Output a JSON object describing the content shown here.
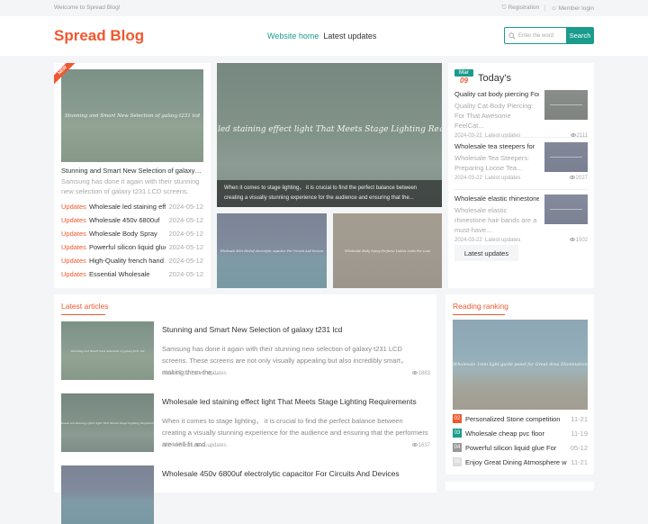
{
  "topbar": {
    "welcome": "Welcome to Spread Blog!",
    "registration": "Registration",
    "member_login": "Member login"
  },
  "header": {
    "logo": "Spread Blog",
    "nav": [
      {
        "label": "Website home",
        "active": true
      },
      {
        "label": "Latest updates",
        "active": false
      }
    ],
    "search_placeholder": "Enter the word",
    "search_button": "Search"
  },
  "featured": {
    "badge": "NEW",
    "image_caption": "Stunning and Smart New Selection of galaxy t231 lcd",
    "title": "Stunning and Smart New Selection of galaxy t23...",
    "desc": "Samsung has done it again with their stunning new selection of galaxy t231 LCD screens. These...",
    "updates": [
      {
        "tag": "Updates",
        "title": "Wholesale led staining effect",
        "date": "2024-05-12"
      },
      {
        "tag": "Updates",
        "title": "Wholesale 450v 6800uf",
        "date": "2024-05-12"
      },
      {
        "tag": "Updates",
        "title": "Wholesale Body Spray",
        "date": "2024-05-12"
      },
      {
        "tag": "Updates",
        "title": "Powerful silicon liquid glue",
        "date": "2024-05-12"
      },
      {
        "tag": "Updates",
        "title": "High-Quality french hand",
        "date": "2024-05-12"
      },
      {
        "tag": "Updates",
        "title": "Essential Wholesale",
        "date": "2024-05-12"
      }
    ]
  },
  "slider": {
    "main_image_caption": "Wholesale led staining effect light That Meets Stage Lighting Requirements",
    "main_desc": "When it comes to stage lighting， it is crucial to find the perfect balance between creating a visually stunning experience for the audience and ensuring that the...",
    "small1_caption": "Wholesale 450v 6800uf electrolytic capacitor For Circuits And Devices",
    "small2_caption": "Wholesale Body Spray Perfume Ladies Lasts For Less"
  },
  "today": {
    "month": "Mar",
    "day": "09",
    "title": "Today's",
    "items": [
      {
        "title": "Quality cat body piercing For",
        "desc": "Quality Cat Body Piercing: For That Awesome FeelCat...",
        "date": "2024-03-22",
        "category": "Latest updates",
        "views": "2111"
      },
      {
        "title": "Wholesale tea steepers for",
        "desc": "Wholesale Tea Steepers: Preparing Loose Tea...",
        "date": "2024-03-22",
        "category": "Latest updates",
        "views": "2027"
      },
      {
        "title": "Wholesale elastic rhinestone",
        "desc": "Wholesale elastic rhinestone hair bands are a must-have...",
        "date": "2024-03-22",
        "category": "Latest updates",
        "views": "1502"
      }
    ],
    "more_button": "Latest updates"
  },
  "latest": {
    "section_title": "Latest articles",
    "articles": [
      {
        "image_caption": "Stunning and Smart New Selection of galaxy t231 lcd",
        "title": "Stunning and Smart New Selection of galaxy t231 lcd",
        "desc": "Samsung has done it again with their stunning new selection of galaxy t231 LCD screens. These screens are not only visually appealing but also incredibly smart， making them the...",
        "date": "2024-05-12",
        "category": "Latest updates",
        "views": "1883"
      },
      {
        "image_caption": "Wholesale led staining effect light That Meets Stage Lighting Requirements",
        "title": "Wholesale led staining effect light That Meets Stage Lighting Requirements",
        "desc": "When it comes to stage lighting， it is crucial to find the perfect balance between creating a visually stunning experience for the audience and ensuring that the performers are well-lit and...",
        "date": "2024-05-12",
        "category": "Latest updates",
        "views": "1637"
      },
      {
        "image_caption": "",
        "title": "Wholesale 450v 6800uf electrolytic capacitor For Circuits And Devices",
        "desc": "",
        "date": "",
        "category": "",
        "views": ""
      }
    ]
  },
  "ranking": {
    "section_title": "Reading ranking",
    "image_caption": "Wholesale 1mm light guide panel for Great Area Illumination",
    "items": [
      {
        "num": "02",
        "title": "Personalized Stone competition",
        "date": "11-21",
        "color": "#f0582f"
      },
      {
        "num": "03",
        "title": "Wholesale cheap pvc floor",
        "date": "11-19",
        "color": "#1a9c8c"
      },
      {
        "num": "04",
        "title": "Powerful silicon liquid glue For",
        "date": "05-12",
        "color": "#999999"
      },
      {
        "num": "05",
        "title": "Enjoy Great Dining Atmosphere with",
        "date": "11-21",
        "color": "#dddddd"
      }
    ]
  }
}
